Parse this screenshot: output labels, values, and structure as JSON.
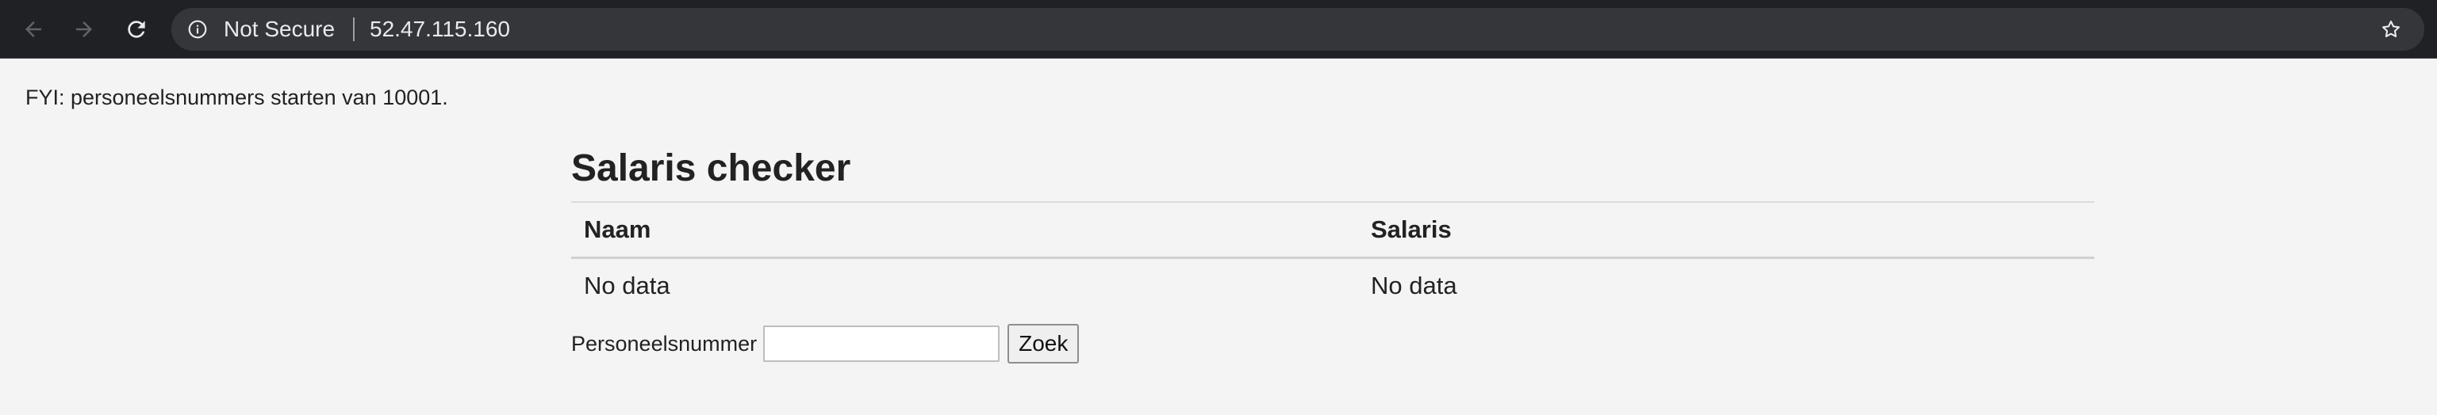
{
  "browser": {
    "security_label": "Not Secure",
    "url": "52.47.115.160",
    "icons": {
      "back": "arrow-left-icon",
      "forward": "arrow-right-icon",
      "reload": "reload-icon",
      "info": "info-icon",
      "bookmark": "star-icon"
    },
    "colors": {
      "toolbar_bg": "#202124",
      "omnibox_bg": "#35363a",
      "text": "#e8eaed"
    }
  },
  "page": {
    "fyi_text": "FYI: personeelsnummers starten van 10001.",
    "title": "Salaris checker",
    "table": {
      "headers": [
        "Naam",
        "Salaris"
      ],
      "rows": [
        [
          "No data",
          "No data"
        ]
      ]
    },
    "search": {
      "label": "Personeelsnummer",
      "value": "",
      "placeholder": "",
      "button_label": "Zoek"
    }
  }
}
